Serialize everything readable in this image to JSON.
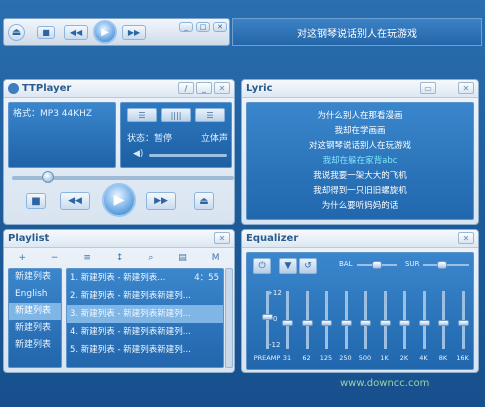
{
  "colors": {
    "bg": "#1e5d9b",
    "panel": "#2a72ba",
    "accent": "#7fe6ff"
  },
  "minibar": {
    "icons": [
      "eject-icon",
      "stop-icon",
      "prev-icon",
      "play-icon",
      "next-icon",
      "restore-icon",
      "close-icon"
    ],
    "title": "对这钢琴说话别人在玩游戏"
  },
  "player": {
    "title": "TTPlayer",
    "format": "格式：MP3  44KHZ",
    "status_label": "状态：暂停",
    "channel": "立体声",
    "buttons": {
      "stop": "■",
      "prev": "◀◀",
      "play": "▶",
      "next": "▶▶",
      "eject": "⏏"
    }
  },
  "lyric": {
    "title": "Lyric",
    "lines": [
      "为什么别人在那看漫画",
      "我却在学画画",
      "对这钢琴说话别人在玩游戏",
      "我却在躲在家背abc",
      "我说我要一架大大的飞机",
      "我却得到一只旧旧螺旋机",
      "为什么要听妈妈的话"
    ],
    "current_index": 3
  },
  "playlist": {
    "title": "Playlist",
    "toolbar": [
      "+",
      "−",
      "≡",
      "↕",
      "⌕",
      "▤",
      "M"
    ],
    "groups": [
      "新建列表",
      "English",
      "新建列表",
      "新建列表",
      "新建列表"
    ],
    "selected_group": 2,
    "tracks": [
      {
        "text": "1. 新建列表 - 新建列表...",
        "dur": "4：55"
      },
      {
        "text": "2. 新建列表 - 新建列表新建列..."
      },
      {
        "text": "3. 新建列表 - 新建列表新建列..."
      },
      {
        "text": "4. 新建列表 - 新建列表新建列..."
      },
      {
        "text": "5. 新建列表 - 新建列表新建列..."
      }
    ],
    "selected_track": 2
  },
  "eq": {
    "title": "Equalizer",
    "bal": "BAL",
    "sur": "SUR",
    "scale_top": "+12",
    "scale_mid": "0",
    "scale_bot": "-12",
    "bands": [
      "PREAMP",
      "31",
      "62",
      "125",
      "250",
      "500",
      "1K",
      "2K",
      "4K",
      "8K",
      "16K"
    ],
    "levels": [
      0.45,
      0.55,
      0.55,
      0.55,
      0.55,
      0.55,
      0.55,
      0.55,
      0.55,
      0.55,
      0.55
    ]
  },
  "watermark": "www.downcc.com"
}
